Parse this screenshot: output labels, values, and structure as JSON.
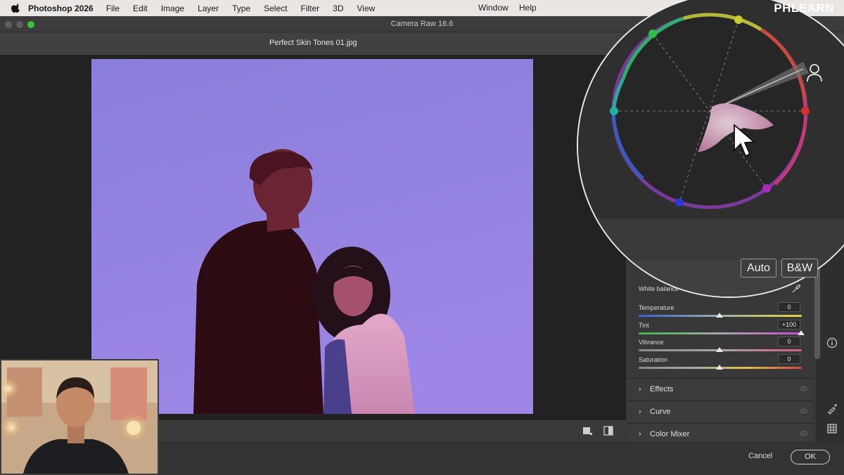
{
  "menubar": {
    "app_name": "Photoshop 2026",
    "items": [
      "File",
      "Edit",
      "Image",
      "Layer",
      "Type",
      "Select",
      "Filter",
      "3D",
      "View"
    ],
    "right_items": [
      "Window",
      "Help"
    ],
    "watermark": "PHLEARN"
  },
  "window": {
    "title": "Camera Raw 18.6",
    "file_name": "Perfect Skin Tones 01.jpg"
  },
  "panel": {
    "auto_label": "Auto",
    "bw_label": "B&W",
    "white_balance_label": "White balance",
    "sliders": [
      {
        "label": "Temperature",
        "value": "0"
      },
      {
        "label": "Tint",
        "value": "+100"
      },
      {
        "label": "Vibrance",
        "value": "0"
      },
      {
        "label": "Saturation",
        "value": "0"
      }
    ],
    "sections": [
      "Effects",
      "Curve",
      "Color Mixer"
    ]
  },
  "footer": {
    "cancel_label": "Cancel",
    "ok_label": "OK"
  },
  "colors": {
    "photo_background": "#8f7fdd",
    "traffic_close": "#5e5e5e",
    "traffic_min": "#5e5e5e",
    "traffic_max": "#3ac43c",
    "accent_ring": "#e8e8e8"
  },
  "icons": [
    "apple-icon",
    "eyedropper-icon",
    "person-icon",
    "info-icon",
    "brush-icon",
    "grid-icon",
    "mouse-cursor-icon",
    "eye-icon",
    "chevron-right-icon"
  ]
}
